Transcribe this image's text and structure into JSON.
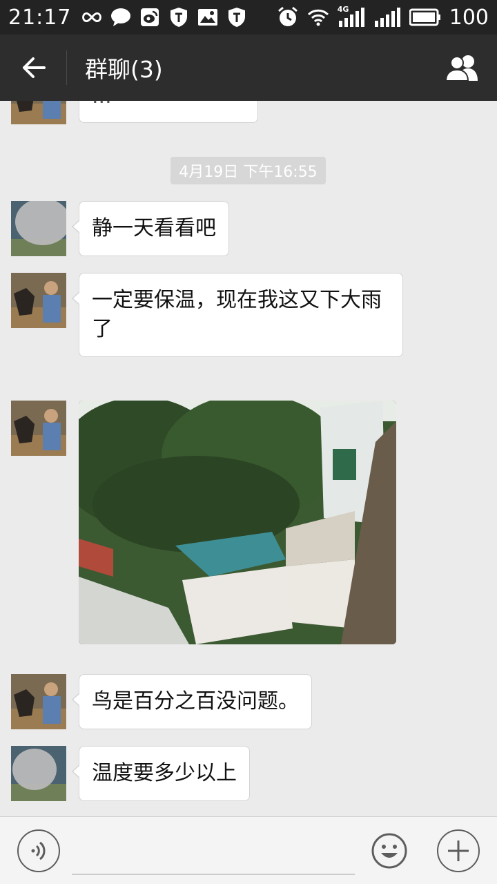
{
  "status_bar": {
    "time": "21:17",
    "left_icons": [
      "infinity-icon",
      "chat-bubble-icon",
      "weibo-icon",
      "shield-icon",
      "gallery-icon",
      "shield-icon"
    ],
    "right_icons": [
      "alarm-icon",
      "wifi-icon",
      "signal-4g-icon",
      "signal-icon",
      "battery-icon"
    ],
    "network_label": "4G",
    "battery": "100"
  },
  "title_bar": {
    "title": "群聊(3)",
    "back_icon": "arrow-left-icon",
    "members_icon": "group-icon"
  },
  "messages": [
    {
      "type": "text",
      "avatar": "man-with-dog",
      "text": "...",
      "partial": true
    },
    {
      "type": "timestamp",
      "text": "4月19日 下午16:55"
    },
    {
      "type": "text",
      "avatar": "blurred-person",
      "text": "静一天看看吧"
    },
    {
      "type": "text",
      "avatar": "man-with-dog",
      "text": "一定要保温，现在我这又下大雨了"
    },
    {
      "type": "image",
      "avatar": "man-with-dog",
      "description": "photo"
    },
    {
      "type": "text",
      "avatar": "man-with-dog",
      "text": "鸟是百分之百没问题。"
    },
    {
      "type": "text",
      "avatar": "blurred-person",
      "text": "温度要多少以上"
    }
  ],
  "input_bar": {
    "voice_icon": "voice-icon",
    "emoji_icon": "smiley-icon",
    "more_icon": "plus-icon",
    "value": ""
  },
  "colors": {
    "status_bar_bg": "#232323",
    "title_bar_bg": "#2d2d2d",
    "chat_bg": "#ebebeb",
    "bubble_bg": "#ffffff",
    "timestamp_bg": "#d7d7d7"
  }
}
